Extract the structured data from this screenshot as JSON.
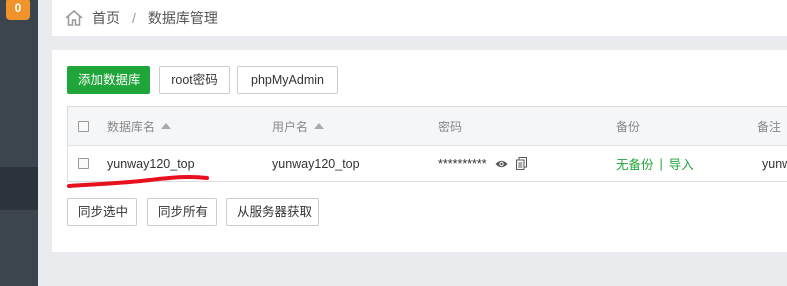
{
  "sidebar": {
    "badge": "0"
  },
  "breadcrumb": {
    "home": "首页",
    "separator": "/",
    "current": "数据库管理"
  },
  "toolbar": {
    "add_db": "添加数据库",
    "root_password": "root密码",
    "phpmyadmin": "phpMyAdmin"
  },
  "table": {
    "headers": {
      "db_name": "数据库名",
      "username": "用户名",
      "password": "密码",
      "backup": "备份",
      "remark": "备注"
    },
    "rows": [
      {
        "db_name": "yunway120_top",
        "username": "yunway120_top",
        "password": "**********",
        "backup_status": "无备份",
        "backup_sep": "|",
        "import": "导入",
        "remark": "yunw"
      }
    ]
  },
  "bottom_actions": {
    "sync_selected": "同步选中",
    "sync_all": "同步所有",
    "fetch_from_server": "从服务器获取"
  },
  "colors": {
    "accent": "#20a53a",
    "badge": "#f0932b",
    "annotation": "#e8101e"
  }
}
